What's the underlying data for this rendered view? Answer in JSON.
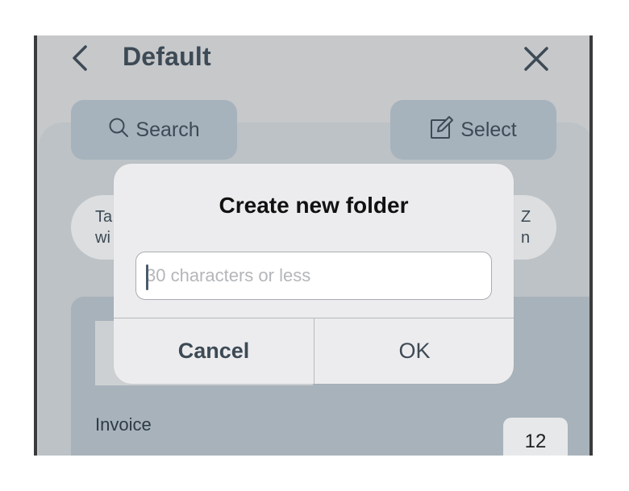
{
  "header": {
    "title": "Default",
    "back_icon": "chevron-left-icon",
    "close_icon": "close-icon"
  },
  "toolbar": {
    "search_label": "Search",
    "search_icon": "search-icon",
    "select_label": "Select",
    "select_icon": "edit-square-icon"
  },
  "chips": {
    "left_line1": "Ta",
    "left_line2": "wi",
    "right_line1": "Z",
    "right_line2": "n"
  },
  "list": {
    "item_label": "Invoice",
    "item_count": "12"
  },
  "dialog": {
    "title": "Create new folder",
    "input_value": "",
    "input_placeholder": "30 characters or less",
    "cancel_label": "Cancel",
    "ok_label": "OK"
  },
  "colors": {
    "overlay_gray": "#c6c8ca",
    "accent_text": "#3d4a55",
    "button_fill": "#a6b2bc",
    "dialog_bg": "#ececee"
  }
}
